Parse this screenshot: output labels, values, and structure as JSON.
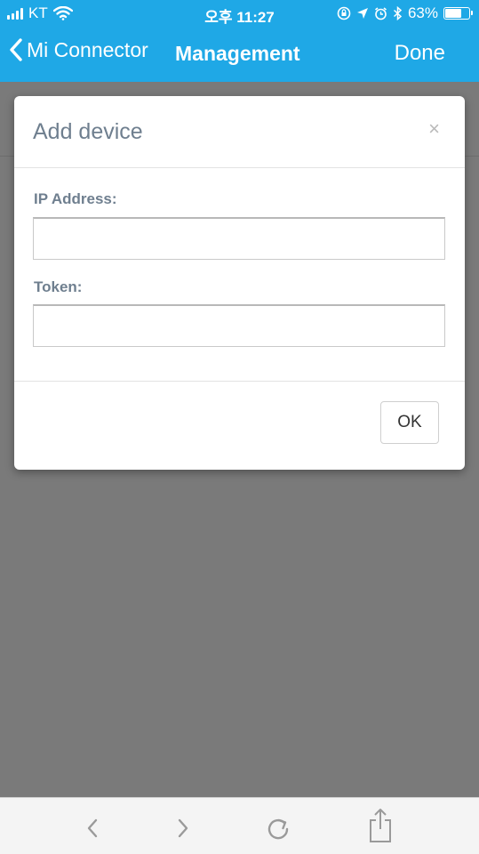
{
  "status": {
    "carrier": "KT",
    "time": "오후 11:27",
    "battery_percent": "63%",
    "battery_level": 0.63
  },
  "nav": {
    "back_label": "Mi Connector",
    "title": "Management",
    "done_label": "Done"
  },
  "modal": {
    "title": "Add device",
    "close_glyph": "×",
    "ip_label": "IP Address:",
    "ip_value": "",
    "token_label": "Token:",
    "token_value": "",
    "ok_label": "OK"
  },
  "toolbar": {
    "items": [
      "back-icon",
      "forward-icon",
      "reload-icon",
      "share-icon"
    ]
  },
  "colors": {
    "accent": "#1fa8e6",
    "overlay": "#7a7a7a",
    "label": "#6f7f8f"
  }
}
